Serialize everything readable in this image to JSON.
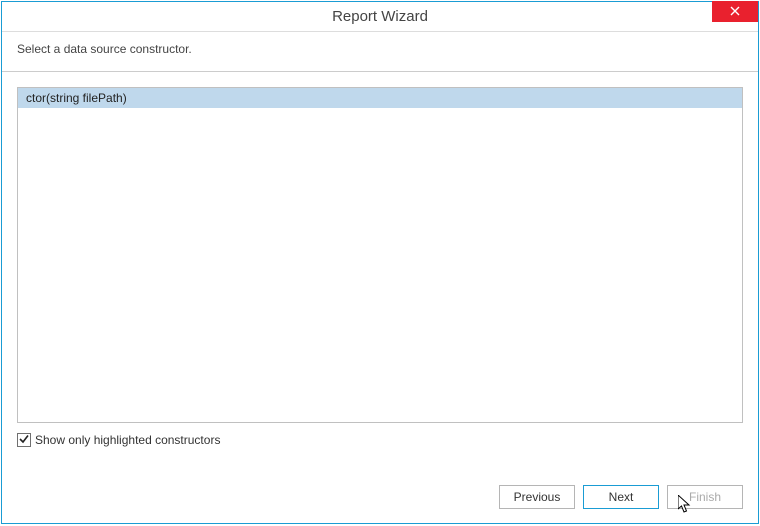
{
  "window": {
    "title": "Report Wizard"
  },
  "instruction": "Select a data source constructor.",
  "constructors": {
    "items": [
      {
        "label": "ctor(string filePath)",
        "selected": true
      }
    ]
  },
  "checkbox": {
    "label": "Show only highlighted constructors",
    "checked": true
  },
  "buttons": {
    "previous": "Previous",
    "next": "Next",
    "finish": "Finish"
  }
}
